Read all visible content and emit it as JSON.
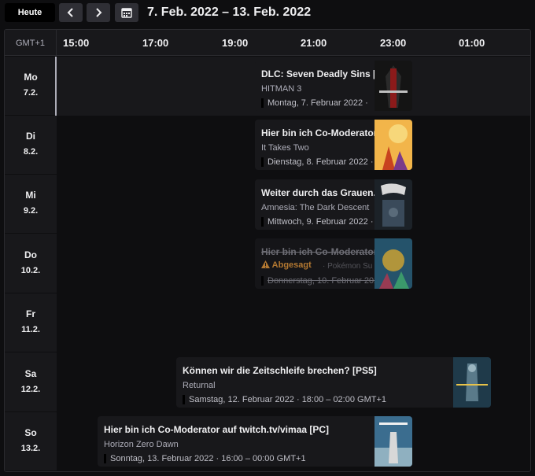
{
  "toolbar": {
    "today_label": "Heute",
    "range": "7. Feb. 2022 – 13. Feb. 2022"
  },
  "grid": {
    "timezone": "GMT+1",
    "hours": [
      "15:00",
      "17:00",
      "19:00",
      "21:00",
      "23:00",
      "01:00"
    ]
  },
  "days": [
    {
      "name": "Mo",
      "date": "7.2."
    },
    {
      "name": "Di",
      "date": "8.2."
    },
    {
      "name": "Mi",
      "date": "9.2."
    },
    {
      "name": "Do",
      "date": "10.2."
    },
    {
      "name": "Fr",
      "date": "11.2."
    },
    {
      "name": "Sa",
      "date": "12.2."
    },
    {
      "name": "So",
      "date": "13.2."
    }
  ],
  "events": [
    {
      "title": "DLC: Seven Deadly Sins [",
      "game": "HITMAN 3",
      "when": "Montag, 7. Februar 2022 ·",
      "color": "#8b1a1a"
    },
    {
      "title": "Hier bin ich Co-Moderator",
      "game": "It Takes Two",
      "when": "Dienstag, 8. Februar 2022 ·",
      "color": "#e8782a"
    },
    {
      "title": "Weiter durch das Grauen.",
      "game": "Amnesia: The Dark Descent",
      "when": "Mittwoch, 9. Februar 2022 ·",
      "color": "#3a4a5a"
    },
    {
      "title": "Hier bin ich Co-Moderator",
      "badge": "Abgesagt",
      "game": "· Pokémon Su",
      "when": "Donnerstag, 10. Februar 202",
      "color": "#2d6a8a"
    },
    {
      "title": "Können wir die Zeitschleife brechen? [PS5]",
      "game": "Returnal",
      "when": "Samstag, 12. Februar 2022 · 18:00 – 02:00 GMT+1",
      "color": "#1f3a4a"
    },
    {
      "title": "Hier bin ich Co-Moderator auf twitch.tv/vimaa [PC]",
      "game": "Horizon Zero Dawn",
      "when": "Sonntag, 13. Februar 2022 · 16:00 – 00:00 GMT+1",
      "color": "#3b6d8f"
    }
  ]
}
